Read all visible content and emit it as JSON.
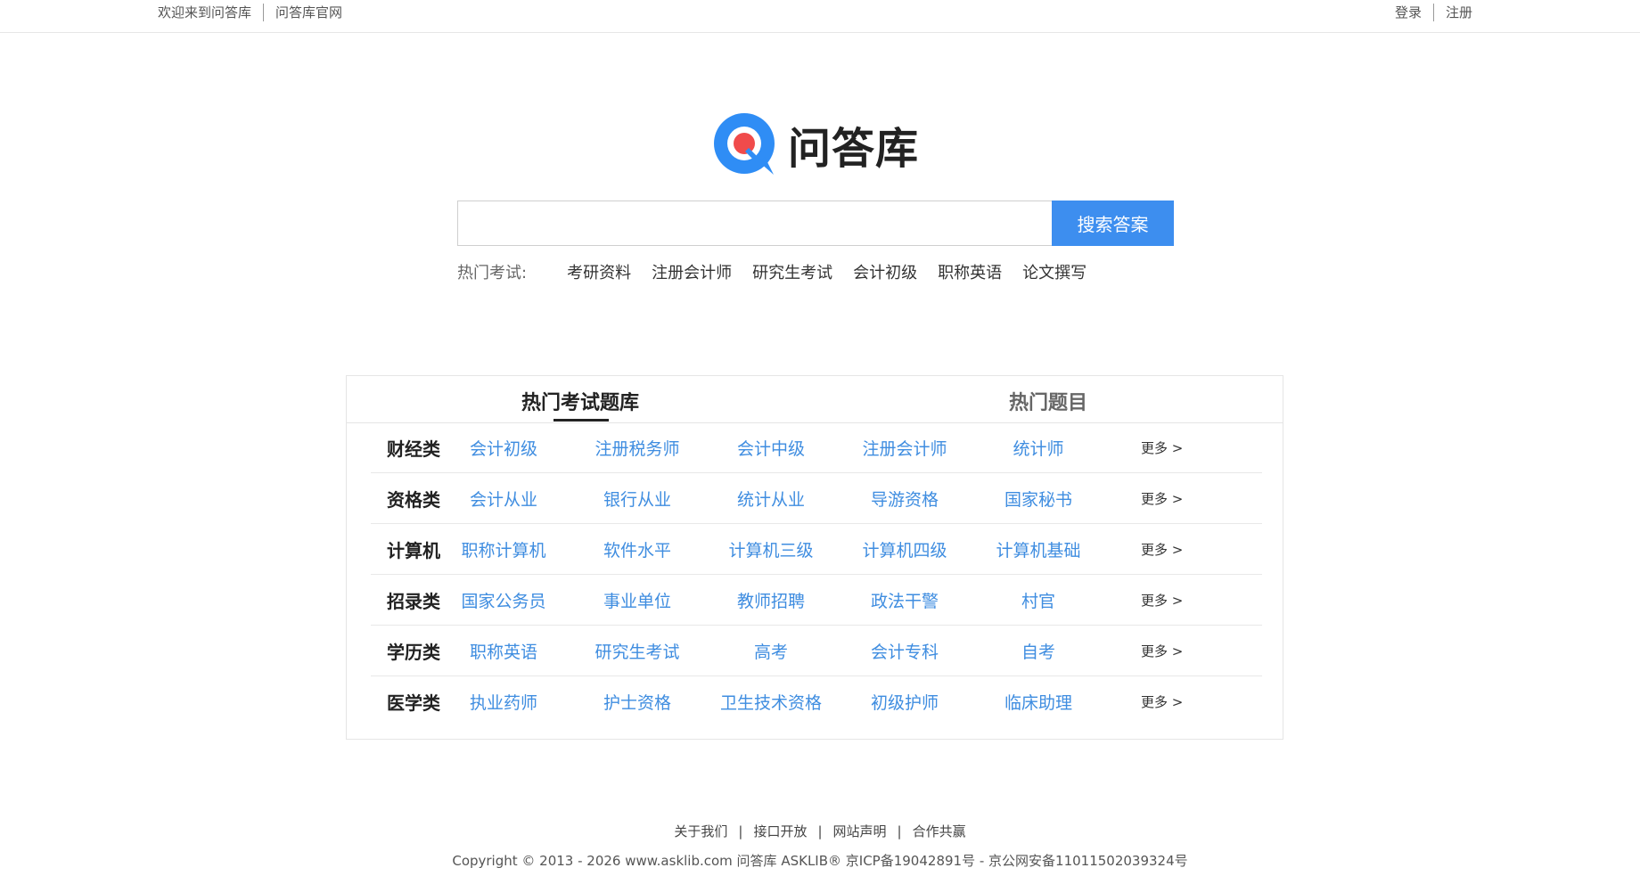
{
  "topbar": {
    "welcome": "欢迎来到问答库",
    "official_site": "问答库官网",
    "login": "登录",
    "register": "注册"
  },
  "logo": {
    "text": "问答库",
    "icon": "q-chat-bubble-icon",
    "brand_color": "#2f8df5",
    "accent_color": "#f04b4b"
  },
  "search": {
    "value": "",
    "placeholder": "",
    "button": "搜索答案"
  },
  "hot_exams": {
    "label": "热门考试:",
    "items": [
      "考研资料",
      "注册会计师",
      "研究生考试",
      "会计初级",
      "职称英语",
      "论文撰写"
    ]
  },
  "panel": {
    "tabs": [
      {
        "label": "热门考试题库"
      },
      {
        "label": "热门题目"
      }
    ],
    "active_tab": 0,
    "more_label": "更多 >",
    "categories": [
      {
        "name": "财经类",
        "items": [
          "会计初级",
          "注册税务师",
          "会计中级",
          "注册会计师",
          "统计师"
        ]
      },
      {
        "name": "资格类",
        "items": [
          "会计从业",
          "银行从业",
          "统计从业",
          "导游资格",
          "国家秘书"
        ]
      },
      {
        "name": "计算机",
        "items": [
          "职称计算机",
          "软件水平",
          "计算机三级",
          "计算机四级",
          "计算机基础"
        ]
      },
      {
        "name": "招录类",
        "items": [
          "国家公务员",
          "事业单位",
          "教师招聘",
          "政法干警",
          "村官"
        ]
      },
      {
        "name": "学历类",
        "items": [
          "职称英语",
          "研究生考试",
          "高考",
          "会计专科",
          "自考"
        ]
      },
      {
        "name": "医学类",
        "items": [
          "执业药师",
          "护士资格",
          "卫生技术资格",
          "初级护师",
          "临床助理"
        ]
      }
    ],
    "link_color": "#3f8de0"
  },
  "footer": {
    "links": [
      "关于我们",
      "接口开放",
      "网站声明",
      "合作共赢"
    ],
    "copyright": "Copyright © 2013 - 2026 www.asklib.com  问答库  ASKLIB® 京ICP备19042891号 - 京公网安备11011502039324号"
  },
  "colors": {
    "search_button": "#3d8eef"
  }
}
